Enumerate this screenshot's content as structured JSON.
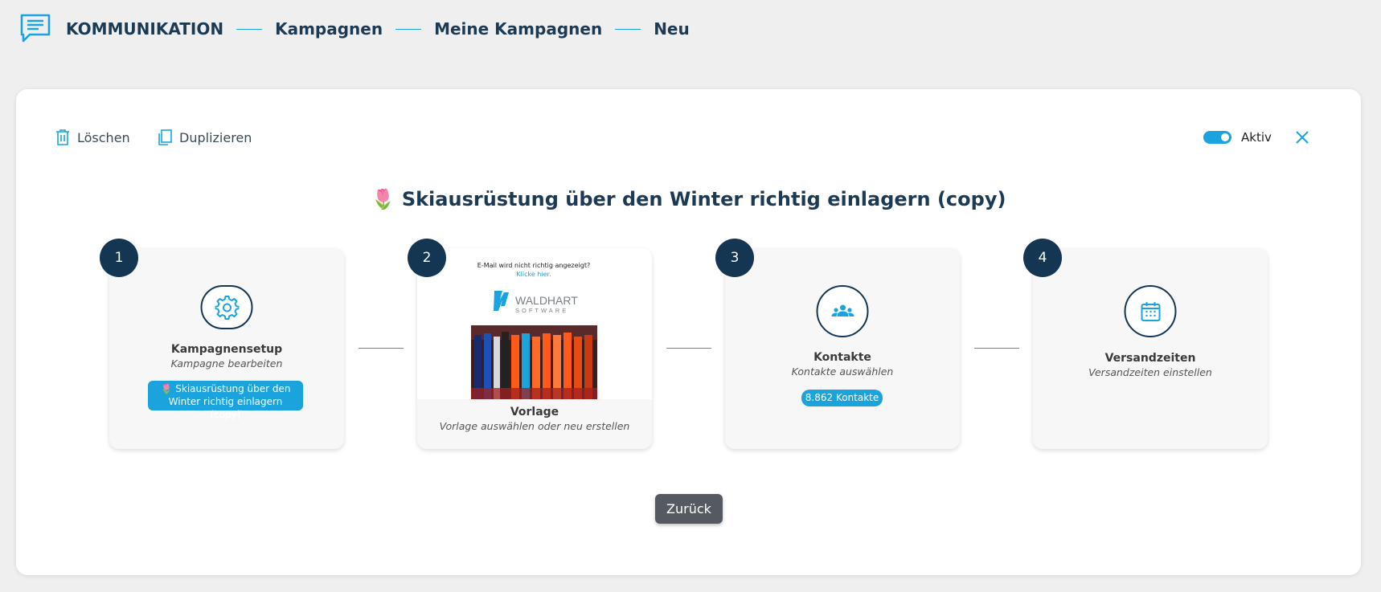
{
  "breadcrumb": [
    "KOMMUNIKATION",
    "Kampagnen",
    "Meine Kampagnen",
    "Neu"
  ],
  "toolbar": {
    "delete_label": "Löschen",
    "duplicate_label": "Duplizieren",
    "active_label": "Aktiv",
    "active": true
  },
  "campaign": {
    "emoji": "🌷",
    "title": "Skiausrüstung über den Winter richtig einlagern (copy)"
  },
  "steps": [
    {
      "number": "1",
      "title": "Kampagnensetup",
      "subtitle": "Kampagne bearbeiten",
      "badge": "🌷 Skiausrüstung über den Winter richtig einlagern (copy)",
      "icon": "gear-icon"
    },
    {
      "number": "2",
      "title": "Vorlage",
      "subtitle": "Vorlage auswählen oder neu erstellen",
      "preview": {
        "note": "E-Mail wird nicht richtig angezeigt?",
        "link": "Klicke hier.",
        "logo_main": "WALDHART",
        "logo_sub": "SOFTWARE"
      }
    },
    {
      "number": "3",
      "title": "Kontakte",
      "subtitle": "Kontakte auswählen",
      "badge": "8.862 Kontakte",
      "icon": "contacts-icon"
    },
    {
      "number": "4",
      "title": "Versandzeiten",
      "subtitle": "Versandzeiten einstellen",
      "icon": "calendar-icon"
    }
  ],
  "back_label": "Zurück",
  "colors": {
    "accent": "#1ba3dd",
    "navy": "#143652",
    "button": "#555a62"
  }
}
